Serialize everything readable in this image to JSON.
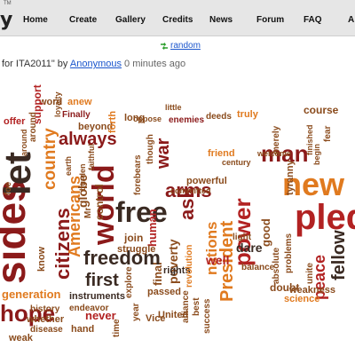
{
  "nav": {
    "logo_fragment": "y",
    "trademark": "TM",
    "items": [
      {
        "label": "Home"
      },
      {
        "label": "Create"
      },
      {
        "label": "Gallery"
      },
      {
        "label": "Credits"
      },
      {
        "label": "News"
      },
      {
        "label": "Forum"
      },
      {
        "label": "FAQ"
      },
      {
        "label": "A"
      }
    ]
  },
  "random": {
    "label": "random"
  },
  "page": {
    "title_fragment": "for ITA2011\" by ",
    "author": "Anonymous",
    "time": "0 minutes ago"
  },
  "cloud": {
    "colors": {
      "dark_red": "#8b1a1a",
      "brown": "#8a4b1c",
      "orange": "#e07a1f",
      "dark": "#3a2a22",
      "red": "#b22222"
    },
    "words": [
      {
        "text": "word"
      },
      {
        "text": "anew"
      },
      {
        "text": "loyalty"
      },
      {
        "text": "Finally"
      },
      {
        "text": "support"
      },
      {
        "text": "beyond"
      },
      {
        "text": "long"
      },
      {
        "text": "forth"
      },
      {
        "text": "always"
      },
      {
        "text": "country"
      },
      {
        "text": "oppose"
      },
      {
        "text": "little"
      },
      {
        "text": "enemies"
      },
      {
        "text": "deeds"
      },
      {
        "text": "truly"
      },
      {
        "text": "course"
      },
      {
        "text": "fear"
      },
      {
        "text": "sides"
      },
      {
        "text": "let"
      },
      {
        "text": "foe"
      },
      {
        "text": "Americans"
      },
      {
        "text": "citizens"
      },
      {
        "text": "globe"
      },
      {
        "text": "free"
      },
      {
        "text": "world"
      },
      {
        "text": "human"
      },
      {
        "text": "ask"
      },
      {
        "text": "arms"
      },
      {
        "text": "war"
      },
      {
        "text": "nations"
      },
      {
        "text": "power"
      },
      {
        "text": "President"
      },
      {
        "text": "man"
      },
      {
        "text": "new"
      },
      {
        "text": "pledge"
      },
      {
        "text": "fellow"
      },
      {
        "text": "peace"
      },
      {
        "text": "unite"
      },
      {
        "text": "committed"
      },
      {
        "text": "friend"
      },
      {
        "text": "welcome"
      },
      {
        "text": "century"
      },
      {
        "text": "finished"
      },
      {
        "text": "good"
      },
      {
        "text": "join"
      },
      {
        "text": "final"
      },
      {
        "text": "poverty"
      },
      {
        "text": "freedom"
      },
      {
        "text": "first"
      },
      {
        "text": "know"
      },
      {
        "text": "generation"
      },
      {
        "text": "hope"
      },
      {
        "text": "instruments"
      },
      {
        "text": "history"
      },
      {
        "text": "endeavor"
      },
      {
        "text": "never"
      },
      {
        "text": "whether"
      },
      {
        "text": "disease"
      },
      {
        "text": "weak"
      },
      {
        "text": "hand"
      },
      {
        "text": "Vice"
      },
      {
        "text": "United"
      },
      {
        "text": "passed"
      },
      {
        "text": "rights"
      },
      {
        "text": "well"
      },
      {
        "text": "light"
      },
      {
        "text": "dare"
      },
      {
        "text": "balance"
      },
      {
        "text": "doubt"
      },
      {
        "text": "science"
      },
      {
        "text": "weakness"
      },
      {
        "text": "absolute"
      },
      {
        "text": "problems"
      },
      {
        "text": "tyranny"
      },
      {
        "text": "struggle"
      },
      {
        "text": "control"
      },
      {
        "text": "powerful"
      },
      {
        "text": "forebears"
      },
      {
        "text": "though"
      },
      {
        "text": "explore"
      },
      {
        "text": "success"
      },
      {
        "text": "best"
      },
      {
        "text": "alliance"
      },
      {
        "text": "year"
      },
      {
        "text": "time"
      },
      {
        "text": "Mr"
      },
      {
        "text": "burden"
      },
      {
        "text": "earth"
      },
      {
        "text": "around"
      },
      {
        "text": "offer"
      },
      {
        "text": "around"
      },
      {
        "text": "revolution"
      },
      {
        "text": "merely"
      },
      {
        "text": "begin"
      },
      {
        "text": "faithful"
      }
    ]
  }
}
